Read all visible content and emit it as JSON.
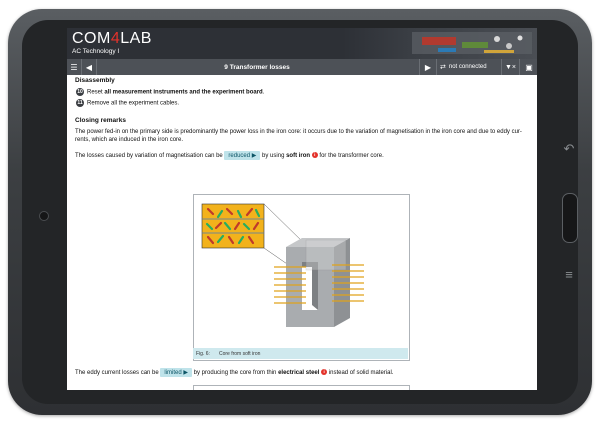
{
  "app": {
    "brand_prefix": "COM",
    "brand_digit": "4",
    "brand_suffix": "LAB",
    "subtitle": "AC Technology I"
  },
  "nav": {
    "menu_icon": "hamburger-icon",
    "back_icon": "left-arrow-icon",
    "title": "9   Transformer losses",
    "forward_icon": "right-arrow-icon",
    "status": "not connected",
    "status_icon": "connection-off-icon",
    "sound_icon": "speaker-muted-icon",
    "folder_icon": "folder-icon"
  },
  "content": {
    "disassembly_heading": "Disassembly",
    "step10_num": "10",
    "step10_pre": "Reset ",
    "step10_bold": "all measurement instruments and the experiment board",
    "step10_post": ".",
    "step11_num": "11",
    "step11_text": "Remove all the experiment cables.",
    "closing_heading": "Closing remarks",
    "para1_line1": "The power fed-in on the primary side is predominantly the power loss in the iron core: it occurs due to the variation of magnetisation in the iron core and due to eddy cur-",
    "para1_line2": "rents, which are induced in the iron core.",
    "para2_pre": "The losses caused by variation of magnetisation can be ",
    "para2_chip": "reduced ▶",
    "para2_mid": " by using ",
    "para2_bold": "soft iron",
    "para2_post": " for the transformer core.",
    "fig_caption_num": "Fig. 6:",
    "fig_caption_text": "Core from soft iron",
    "para3_pre": "The eddy current losses can be ",
    "para3_chip": "limited ▶",
    "para3_mid": " by producing the core from thin ",
    "para3_bold": "electrical steel",
    "para3_post": " instead of solid material.",
    "info_glyph": "i"
  },
  "colors": {
    "brand_red": "#e3322b",
    "chip_bg": "#bfe3ea",
    "caption_bg": "#cfe9ee",
    "nav_bg": "#4d5157",
    "header_bg": "#2d3036"
  }
}
